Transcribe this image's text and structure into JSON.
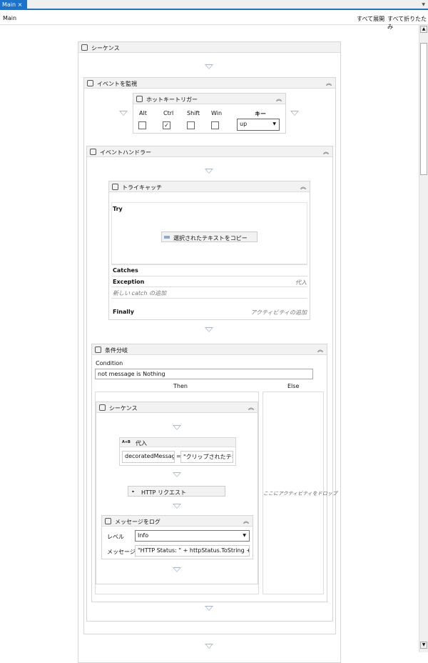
{
  "tab": {
    "label": "Main",
    "close": "×"
  },
  "header": {
    "breadcrumb": "Main",
    "expand_all": "すべて展開",
    "collapse_all": "すべて折りたたみ"
  },
  "sequence": {
    "title": "シーケンス"
  },
  "monitor": {
    "title": "イベントを監視"
  },
  "hotkey": {
    "title": "ホットキートリガー",
    "labels": [
      "Alt",
      "Ctrl",
      "Shift",
      "Win"
    ],
    "checked": [
      false,
      true,
      false,
      false
    ],
    "key_label": "キー",
    "key_value": "up"
  },
  "handler": {
    "title": "イベントハンドラー"
  },
  "trycatch": {
    "title": "トライキャッチ",
    "try": "Try",
    "copy_activity": "選択されたテキストをコピー",
    "catches": "Catches",
    "exception": "Exception",
    "exception_action": "代入",
    "add_catch": "新しい catch の追加",
    "finally": "Finally",
    "add_activity": "アクティビティの追加"
  },
  "ifelse": {
    "title": "条件分岐",
    "condition_label": "Condition",
    "condition": "not message is Nothing",
    "then": "Then",
    "else": "Else",
    "drop_hint": "ここにアクティビティをドロップ"
  },
  "inner_sequence": {
    "title": "シーケンス"
  },
  "assign": {
    "title": "代入",
    "icon_text": "A+B",
    "to": "decoratedMessage",
    "eq": "=",
    "value": "\"クリップされたテキス"
  },
  "http": {
    "title": "HTTP リクエスト"
  },
  "log": {
    "title": "メッセージをログ",
    "level_label": "レベル",
    "level": "Info",
    "message_label": "メッセージ",
    "message": "\"HTTP Status: \" + httpStatus.ToString + Env"
  }
}
